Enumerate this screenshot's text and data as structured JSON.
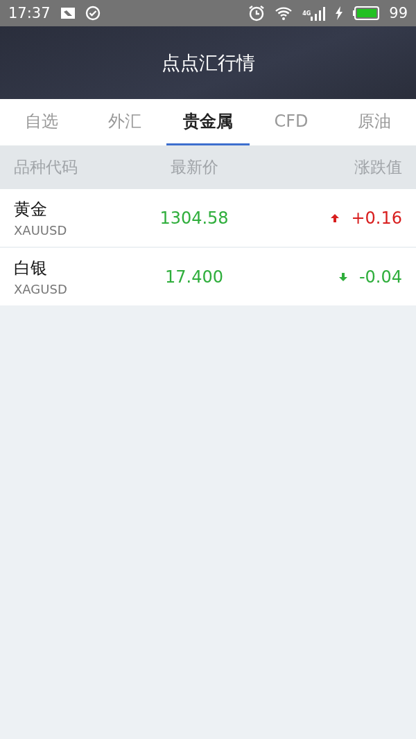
{
  "status_bar": {
    "time": "17:37",
    "network": "4G",
    "battery": "99"
  },
  "header": {
    "title": "点点汇行情"
  },
  "tabs": [
    {
      "label": "自选",
      "selected": false
    },
    {
      "label": "外汇",
      "selected": false
    },
    {
      "label": "贵金属",
      "selected": true
    },
    {
      "label": "CFD",
      "selected": false
    },
    {
      "label": "原油",
      "selected": false
    }
  ],
  "table": {
    "columns": [
      "品种代码",
      "最新价",
      "涨跌值"
    ],
    "rows": [
      {
        "name": "黄金",
        "code": "XAUUSD",
        "price": "1304.58",
        "change": "+0.16",
        "kind": "rise"
      },
      {
        "name": "白银",
        "code": "XAGUSD",
        "price": "17.400",
        "change": "-0.04",
        "kind": "fall"
      }
    ]
  }
}
